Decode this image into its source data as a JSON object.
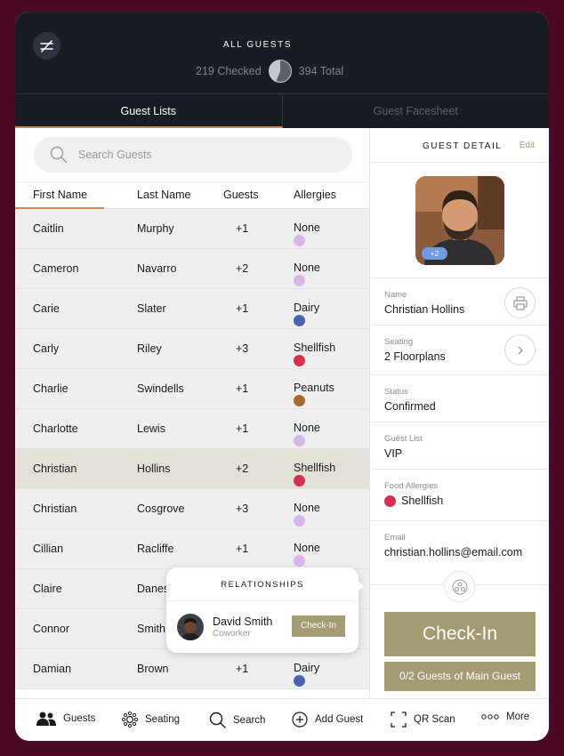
{
  "header": {
    "title": "ALL GUESTS",
    "checked": "219 Checked",
    "total": "394 Total",
    "checked_fraction": 0.56
  },
  "tabs": [
    {
      "label": "Guest Lists",
      "active": true
    },
    {
      "label": "Guest Facesheet",
      "active": false
    }
  ],
  "search": {
    "placeholder": "Search Guests"
  },
  "table": {
    "columns": [
      "First Name",
      "Last Name",
      "Guests",
      "Allergies"
    ],
    "rows": [
      {
        "first": "Caitlin",
        "last": "Murphy",
        "guests": "+1",
        "allergy": "None",
        "color": "#d7b8ea"
      },
      {
        "first": "Cameron",
        "last": "Navarro",
        "guests": "+2",
        "allergy": "None",
        "color": "#d7b8ea"
      },
      {
        "first": "Carie",
        "last": "Slater",
        "guests": "+1",
        "allergy": "Dairy",
        "color": "#4b62ad"
      },
      {
        "first": "Carly",
        "last": "Riley",
        "guests": "+3",
        "allergy": "Shellfish",
        "color": "#d6304f"
      },
      {
        "first": "Charlie",
        "last": "Swindells",
        "guests": "+1",
        "allergy": "Peanuts",
        "color": "#a86a2c"
      },
      {
        "first": "Charlotte",
        "last": "Lewis",
        "guests": "+1",
        "allergy": "None",
        "color": "#d7b8ea"
      },
      {
        "first": "Christian",
        "last": "Hollins",
        "guests": "+2",
        "allergy": "Shellfish",
        "color": "#d6304f",
        "selected": true
      },
      {
        "first": "Christian",
        "last": "Cosgrove",
        "guests": "+3",
        "allergy": "None",
        "color": "#d7b8ea"
      },
      {
        "first": "Cillian",
        "last": "Racliffe",
        "guests": "+1",
        "allergy": "None",
        "color": "#d7b8ea"
      },
      {
        "first": "Claire",
        "last": "Danes",
        "guests": "",
        "allergy": "",
        "color": ""
      },
      {
        "first": "Connor",
        "last": "Smith",
        "guests": "",
        "allergy": "",
        "color": ""
      },
      {
        "first": "Damian",
        "last": "Brown",
        "guests": "+1",
        "allergy": "Dairy",
        "color": "#4b62ad"
      }
    ]
  },
  "detail": {
    "title": "GUEST DETAIL",
    "edit": "Edit",
    "badge": "+2",
    "name_label": "Name",
    "name": "Christian Hollins",
    "seating_label": "Seating",
    "seating": "2 Floorplans",
    "status_label": "Status",
    "status": "Confirmed",
    "list_label": "Guest List",
    "list": "VIP",
    "allergy_label": "Food Allergies",
    "allergy": "Shellfish",
    "allergy_color": "#d6304f",
    "email_label": "Email",
    "email": "christian.hollins@email.com",
    "checkin": "Check-In",
    "guests_main": "0/2 Guests of Main Guest"
  },
  "relationships": {
    "title": "RELATIONSHIPS",
    "name": "David Smith",
    "role": "Coworker",
    "button": "Check-In"
  },
  "bottom_nav": {
    "guests": "Guests",
    "seating": "Seating",
    "search": "Search",
    "add": "Add Guest",
    "qr": "QR Scan",
    "more": "More"
  },
  "colors": {
    "accent": "#a39b74",
    "tab_underline": "#d08a4a",
    "header_bg": "#181c23",
    "background": "#4a0a26"
  }
}
